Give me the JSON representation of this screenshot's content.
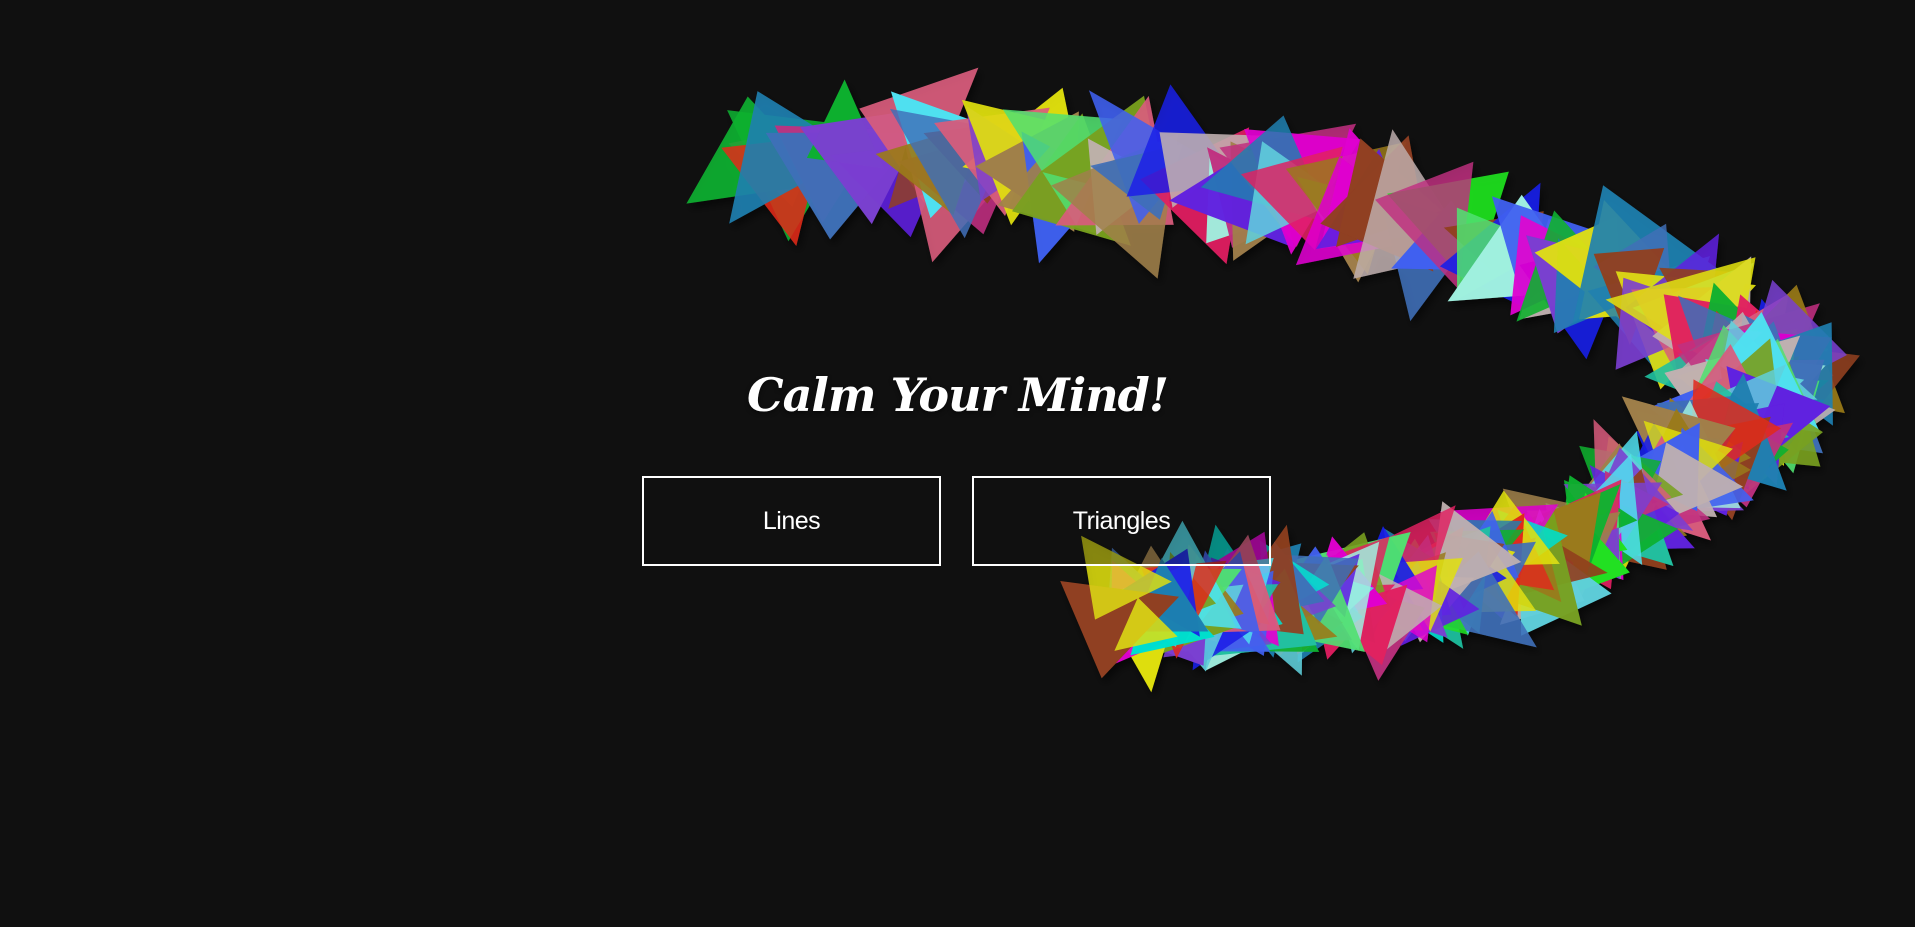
{
  "page": {
    "title": "Calm Your Mind!"
  },
  "buttons": {
    "lines_label": "Lines",
    "triangles_label": "Triangles"
  },
  "colors": {
    "background": "#101010",
    "text": "#ffffff",
    "button_border": "#ffffff",
    "triangle_palette": [
      "#7a3fd0",
      "#1a1ee8",
      "#3f6fb8",
      "#10b030",
      "#50e070",
      "#d85c7c",
      "#5fd0dc",
      "#9a7a1a",
      "#78a020",
      "#1f80b0",
      "#e02a1a",
      "#20e020",
      "#c03080",
      "#00e0d0",
      "#e000d0",
      "#6020e0",
      "#e0e010",
      "#e02060",
      "#a0f0e0",
      "#c0b0b0",
      "#20c0a0",
      "#a0804a",
      "#904020",
      "#4060f0",
      "#50e0f0"
    ]
  }
}
